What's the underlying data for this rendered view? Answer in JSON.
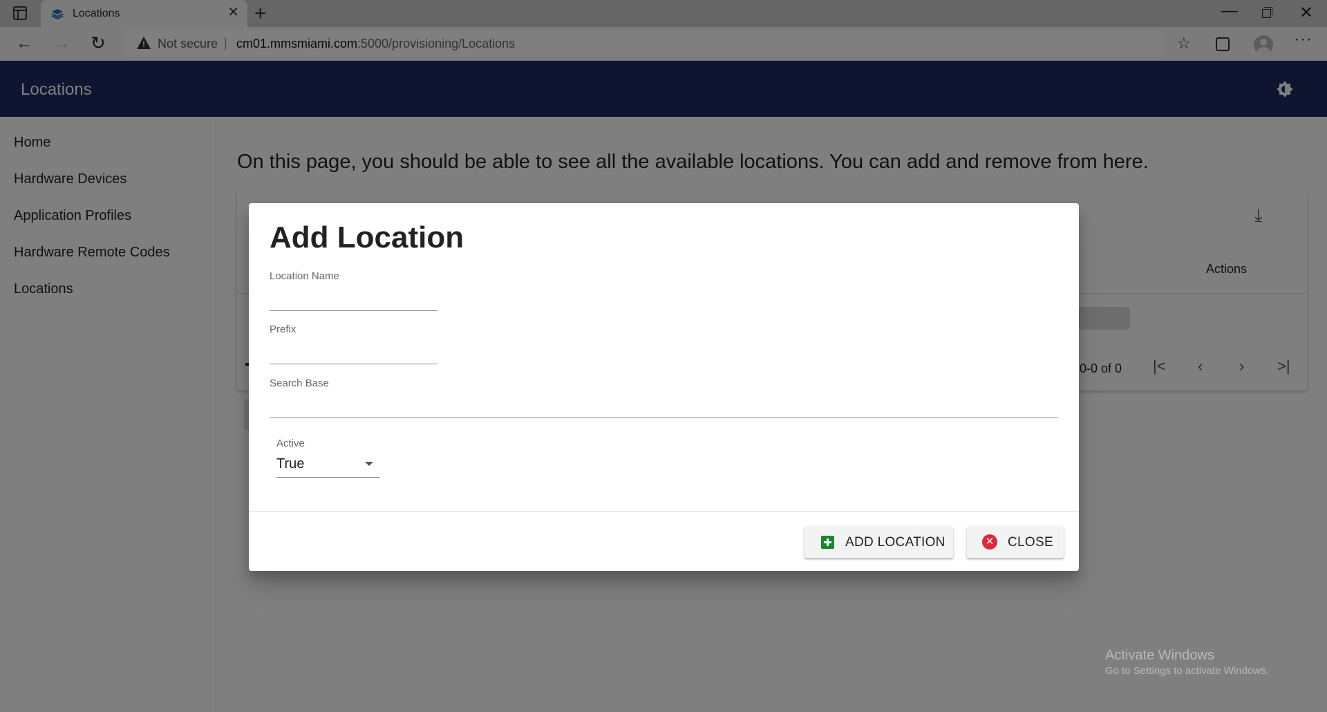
{
  "browser": {
    "tab_title": "Locations",
    "security_label": "Not secure",
    "url_host": "cm01.mmsmiami.com",
    "url_rest": ":5000/provisioning/Locations"
  },
  "app": {
    "title": "Locations"
  },
  "sidebar": {
    "items": [
      {
        "label": "Home"
      },
      {
        "label": "Hardware Devices"
      },
      {
        "label": "Application Profiles"
      },
      {
        "label": "Hardware Remote Codes"
      },
      {
        "label": "Locations"
      }
    ]
  },
  "main": {
    "description": "On this page, you should be able to see all the available locations. You can add and remove from here.",
    "table_actions_header": "Actions",
    "pagination_text": "0-0 of 0"
  },
  "dialog": {
    "title": "Add Location",
    "fields": {
      "location_name": {
        "label": "Location Name",
        "value": ""
      },
      "prefix": {
        "label": "Prefix",
        "value": ""
      },
      "search_base": {
        "label": "Search Base",
        "value": ""
      }
    },
    "active": {
      "label": "Active",
      "value": "True"
    },
    "add_button_label": "ADD LOCATION",
    "close_button_label": "CLOSE"
  },
  "watermark": {
    "line1": "Activate Windows",
    "line2": "Go to Settings to activate Windows."
  },
  "colors": {
    "appbar": "#1e2a63",
    "add_icon": "#16892b",
    "close_icon": "#e0283a"
  }
}
